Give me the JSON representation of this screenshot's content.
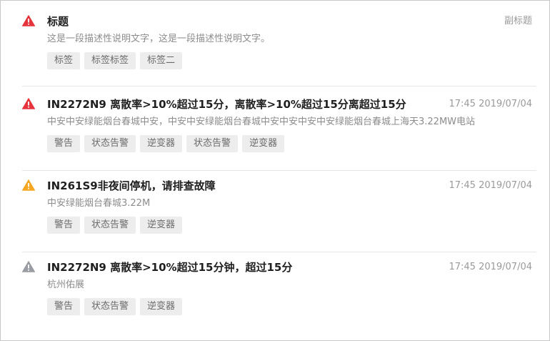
{
  "colors": {
    "danger": "#e5343d",
    "warning": "#f5a623",
    "neutral": "#9a9ca3"
  },
  "items": [
    {
      "icon": "alert-triangle-icon",
      "level": "danger",
      "title": "标题",
      "meta": "副标题",
      "description": "这是一段描述性说明文字，这是一段描述性说明文字。",
      "tags": [
        "标签",
        "标签标签",
        "标签二"
      ]
    },
    {
      "icon": "alert-triangle-icon",
      "level": "danger",
      "title": "IN2272N9 离散率>10%超过15分，离散率>10%超过15分离超过15分",
      "meta": "17:45 2019/07/04",
      "description": "中安中安绿能烟台春城中安，中安中安绿能烟台春城中安中安中安中安绿能烟台春城上海天3.22MW电站",
      "tags": [
        "警告",
        "状态告警",
        "逆变器",
        "状态告警",
        "逆变器"
      ]
    },
    {
      "icon": "alert-triangle-icon",
      "level": "warning",
      "title": "IN261S9非夜间停机，请排查故障",
      "meta": "17:45 2019/07/04",
      "description": "中安绿能烟台春城3.22M",
      "tags": [
        "警告",
        "状态告警",
        "逆变器"
      ]
    },
    {
      "icon": "alert-triangle-icon",
      "level": "neutral",
      "title": "IN2272N9 离散率>10%超过15分钟，超过15分",
      "meta": "17:45 2019/07/04",
      "description": "杭州佑展",
      "tags": [
        "警告",
        "状态告警",
        "逆变器"
      ]
    }
  ]
}
